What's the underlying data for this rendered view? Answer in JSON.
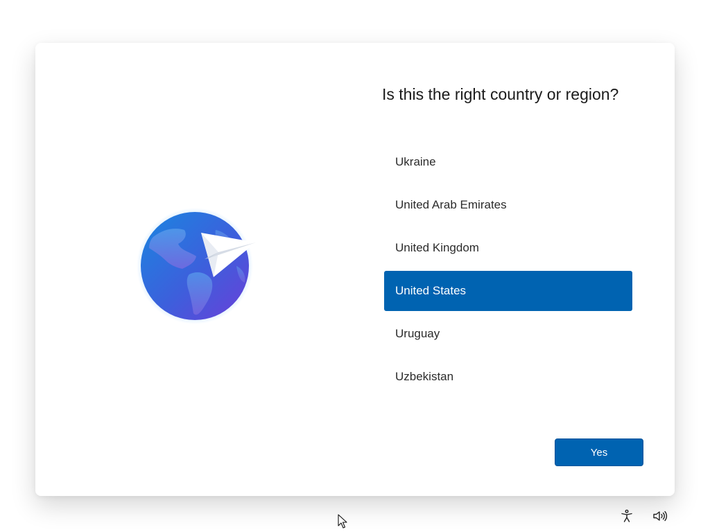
{
  "oobe": {
    "title": "Is this the right country or region?",
    "countries": [
      {
        "label": "Ukraine",
        "selected": false
      },
      {
        "label": "United Arab Emirates",
        "selected": false
      },
      {
        "label": "United Kingdom",
        "selected": false
      },
      {
        "label": "United States",
        "selected": true
      },
      {
        "label": "Uruguay",
        "selected": false
      },
      {
        "label": "Uzbekistan",
        "selected": false
      }
    ],
    "yes_label": "Yes"
  },
  "icons": {
    "illustration": "globe-paper-plane-illustration",
    "accessibility": "accessibility-icon",
    "volume": "volume-icon",
    "cursor": "mouse-cursor-icon"
  },
  "colors": {
    "accent": "#0063b1",
    "selected_text": "#ffffff",
    "text": "#2b2b2b",
    "background": "#ffffff"
  }
}
